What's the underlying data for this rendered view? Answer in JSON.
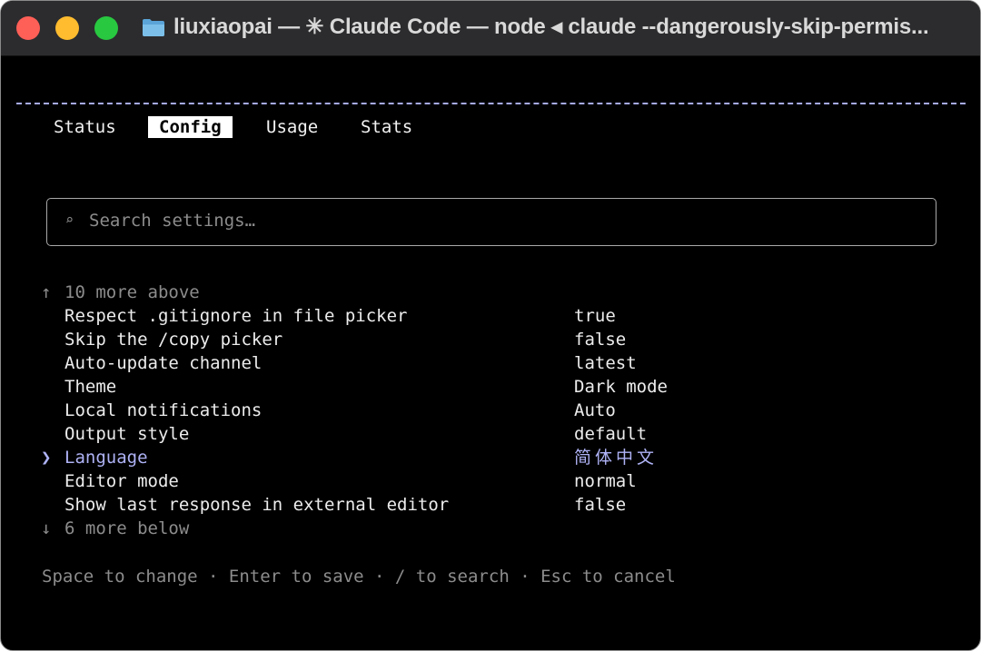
{
  "window": {
    "title": "liuxiaopai — ✳ Claude Code — node ◂ claude --dangerously-skip-permis...",
    "icon": "folder-icon",
    "background": "#000000",
    "accent": "#aeb2f5"
  },
  "tabs": [
    {
      "label": "Status",
      "active": false
    },
    {
      "label": "Config",
      "active": true
    },
    {
      "label": "Usage",
      "active": false
    },
    {
      "label": "Stats",
      "active": false
    }
  ],
  "search": {
    "icon_glyph": "⌕",
    "placeholder": "Search settings…",
    "value": ""
  },
  "settings": {
    "more_above": {
      "arrow": "↑",
      "text": "10 more above"
    },
    "selected_marker": "❯",
    "items": [
      {
        "label": "Respect .gitignore in file picker",
        "value": "true"
      },
      {
        "label": "Skip the /copy picker",
        "value": "false"
      },
      {
        "label": "Auto-update channel",
        "value": "latest"
      },
      {
        "label": "Theme",
        "value": "Dark mode"
      },
      {
        "label": "Local notifications",
        "value": "Auto"
      },
      {
        "label": "Output style",
        "value": "default"
      },
      {
        "label": "Language",
        "value": "简体中文",
        "selected": true
      },
      {
        "label": "Editor mode",
        "value": "normal"
      },
      {
        "label": "Show last response in external editor",
        "value": "false"
      }
    ],
    "more_below": {
      "arrow": "↓",
      "text": "6 more below"
    }
  },
  "help_text": "Space to change · Enter to save · / to search · Esc to cancel"
}
